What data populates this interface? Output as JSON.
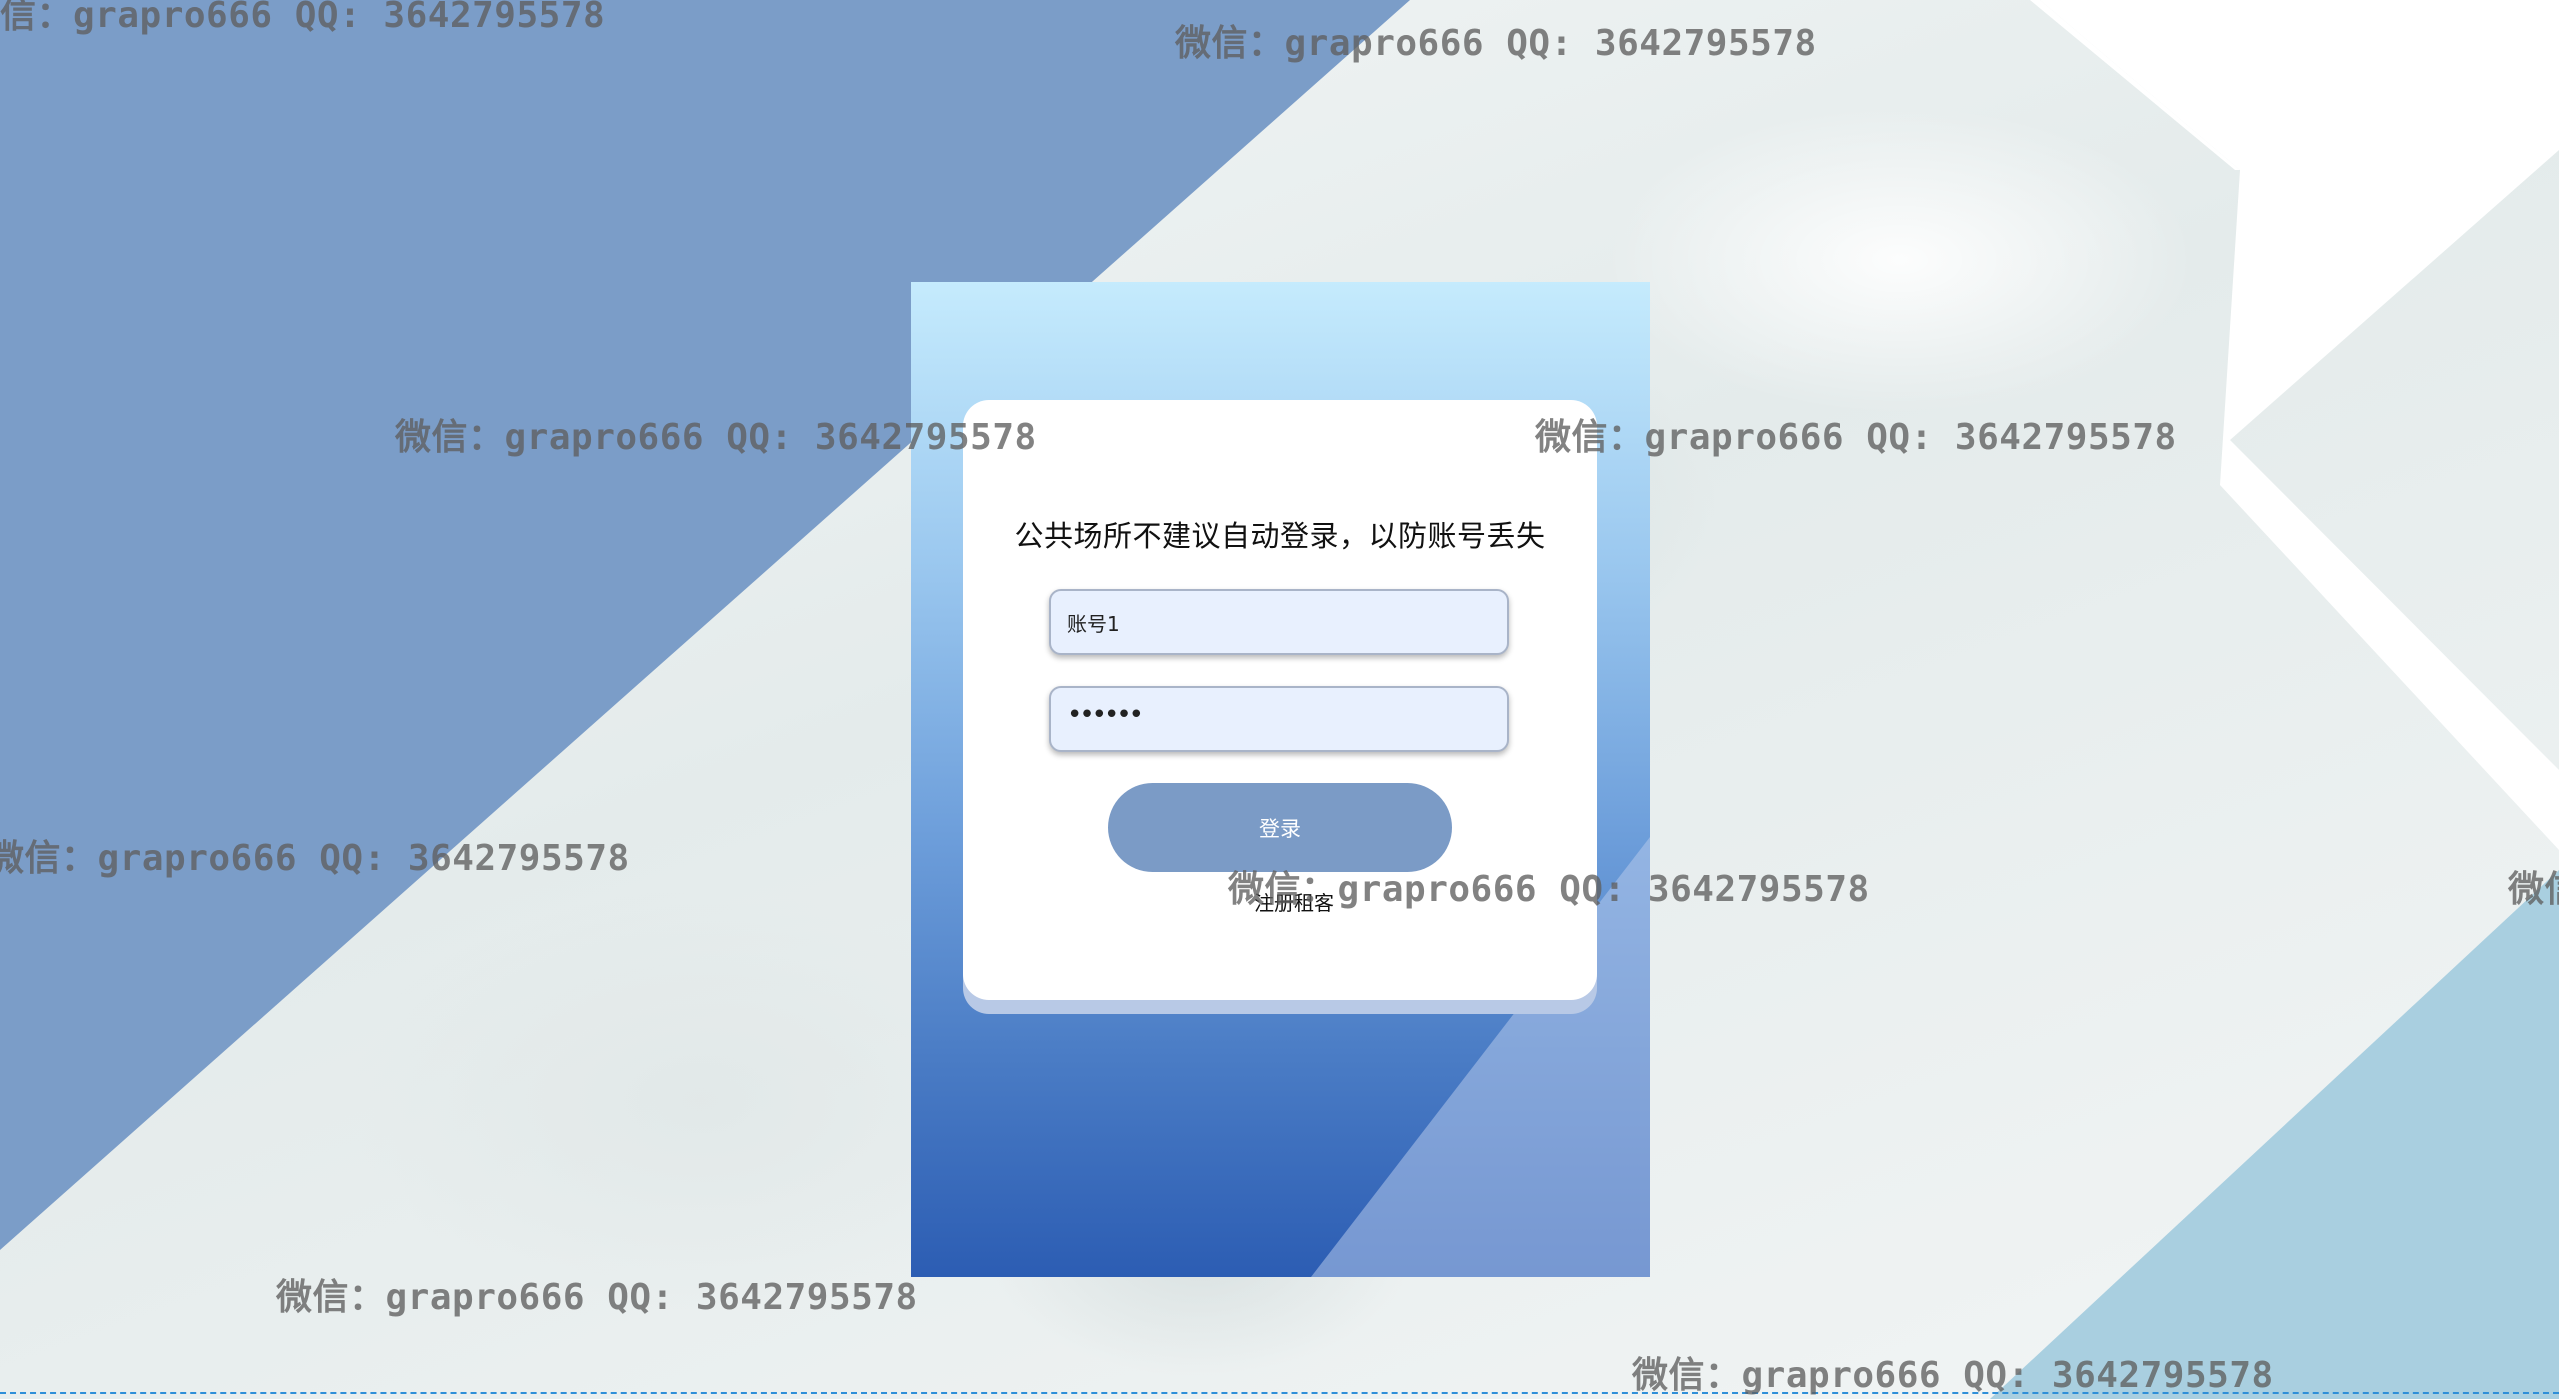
{
  "login": {
    "notice": "公共场所不建议自动登录，以防账号丢失",
    "username_value": "账号1",
    "password_masked": "••••••",
    "login_label": "登录",
    "register_label": "注册租客"
  },
  "watermark": {
    "full": "微信：grapro666 QQ: 3642795578",
    "top_left_partial": "信：grapro666 QQ: 3642795578",
    "left_partial": "微信：grapro666 QQ: 3642795578",
    "right_edge_partial": "微信"
  },
  "colors": {
    "blue_triangle": "#7b9dc8",
    "panel_top": "#c5ebfd",
    "panel_bottom": "#2c5db3",
    "bottom_right_triangle": "#a9cfe0",
    "login_button": "#7b9bc6",
    "input_fill": "#e8f0fe"
  }
}
